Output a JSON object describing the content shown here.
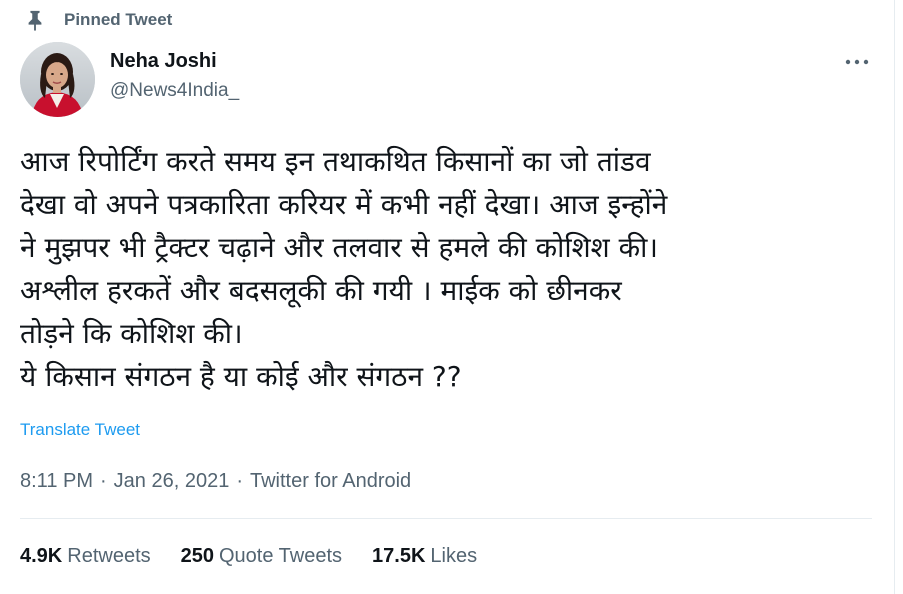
{
  "pinned": {
    "label": "Pinned Tweet",
    "icon": "pin-icon"
  },
  "author": {
    "name": "Neha Joshi",
    "handle": "@News4India_"
  },
  "more_icon": "more-horizontal-icon",
  "tweet": {
    "lines": [
      "आज रिपोर्टिंग करते समय इन तथाकथित किसानों का जो तांडव",
      "देखा वो अपने पत्रकारिता करियर में कभी नहीं देखा। आज इन्होंने",
      "ने मुझपर भी ट्रैक्टर चढ़ाने और तलवार से हमले की कोशिश की।",
      "अश्लील हरकतें और बदसलूकी की गयी । माईक को छीनकर",
      "तोड़ने कि कोशिश की।",
      "ये किसान संगठन है या कोई और संगठन ??"
    ]
  },
  "translate_label": "Translate Tweet",
  "meta": {
    "time": "8:11 PM",
    "separator": "·",
    "date": "Jan 26, 2021",
    "source": "Twitter for Android"
  },
  "stats": {
    "retweets": {
      "count": "4.9K",
      "label": "Retweets"
    },
    "quotes": {
      "count": "250",
      "label": "Quote Tweets"
    },
    "likes": {
      "count": "17.5K",
      "label": "Likes"
    }
  },
  "colors": {
    "link": "#1d9bf0",
    "muted": "#536471",
    "text": "#0f1419",
    "divider": "#e6ecf0"
  }
}
